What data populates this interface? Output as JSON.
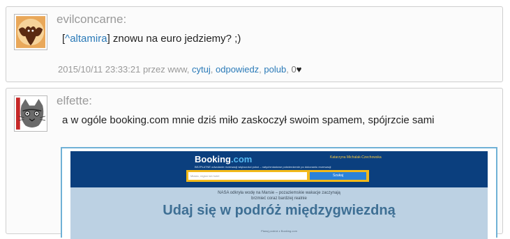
{
  "comments": [
    {
      "username": "evilconcarne:",
      "reply_open": "[",
      "reply_link": "^altamira",
      "reply_close": "]",
      "text": " znowu na euro jedziemy? ;)",
      "meta": {
        "timestamp": "2015/10/11 23:33:21",
        "by": "przez www,",
        "cite": "cytuj",
        "reply": "odpowiedz",
        "like": "polub",
        "count": "0",
        "heart": "♥"
      }
    },
    {
      "username": "elfette:",
      "text": "a w ogóle booking.com mnie dziś miło zaskoczył swoim spamem, spójrzcie sami"
    }
  ],
  "embed": {
    "logo_main": "Booking",
    "logo_dot": ".com",
    "user_name": "Katarzyna Michalak-Czechowska",
    "tagline": "BEZPŁATNE odwołanie rezerwacji większości pokoi – natychmiastowe potwierdzenie po dokonaniu rezerwacji",
    "search_placeholder": "Miasto, region lub hotel",
    "search_button": "Szukaj",
    "promo_line1": "NASA odkryła wodę na Marsie – pozaziemskie wakacje zaczynają",
    "promo_line2": "brzmieć coraz bardziej realnie",
    "headline": "Udaj się w podróż międzygwiezdną",
    "subline": "Planuj podróż z Booking.com"
  },
  "colors": {
    "link": "#2a7ab8",
    "booking_blue": "#0b3f7e",
    "booking_yellow": "#f2b91a"
  }
}
